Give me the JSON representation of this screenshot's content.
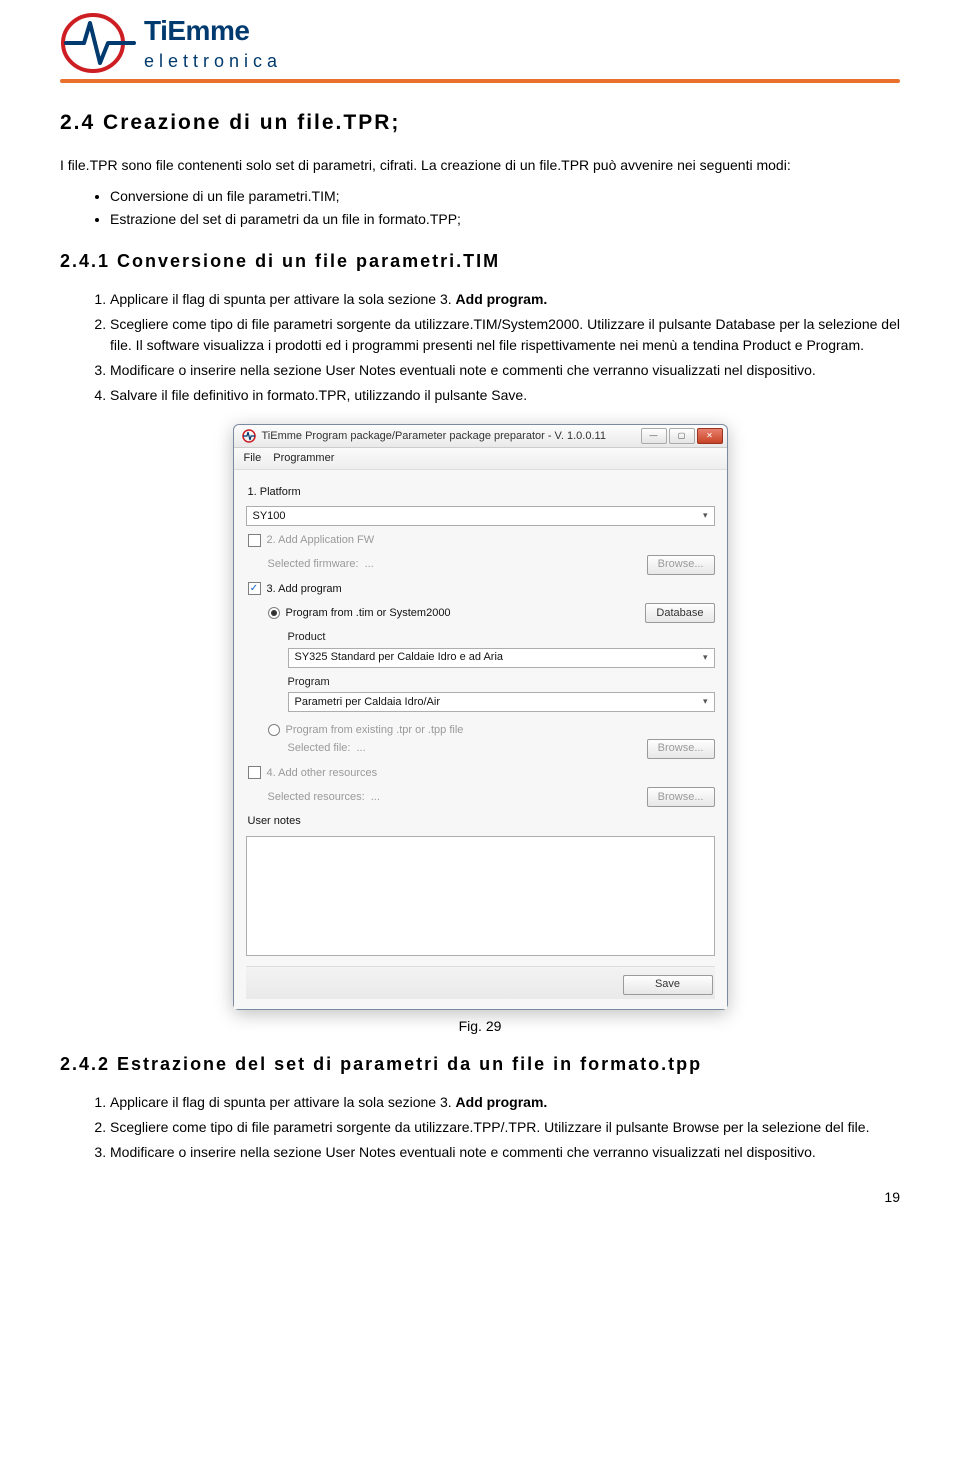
{
  "logo": {
    "brand_top": "TiEmme",
    "brand_bot": "elettronica"
  },
  "section24": {
    "title": "2.4   Creazione di un file.TPR;",
    "intro": "I file.TPR sono file contenenti solo set di parametri, cifrati. La creazione di un file.TPR può avvenire nei seguenti modi:",
    "bullets": [
      "Conversione di un file parametri.TIM;",
      "Estrazione del set di parametri da un file in formato.TPP;"
    ]
  },
  "section241": {
    "title": "2.4.1   Conversione di un file parametri.TIM",
    "steps": [
      "Applicare il flag di spunta per attivare la sola sezione 3. <b>Add program.</b>",
      "Scegliere come tipo di file parametri sorgente da utilizzare.TIM/System2000. Utilizzare il pulsante Database per la selezione del file. Il software visualizza i prodotti ed i programmi presenti nel file rispettivamente nei menù a tendina Product e Program.",
      "Modificare o inserire nella sezione User Notes eventuali note e commenti che verranno visualizzati nel dispositivo.",
      "Salvare il file definitivo in formato.TPR, utilizzando il pulsante Save."
    ]
  },
  "figure": {
    "caption": "Fig. 29"
  },
  "section242": {
    "title": "2.4.2   Estrazione del set di parametri da un file in formato.tpp",
    "steps": [
      "Applicare il flag di spunta per attivare la sola sezione 3. <b>Add program.</b>",
      "Scegliere come tipo di file parametri sorgente da utilizzare.TPP/.TPR. Utilizzare il pulsante Browse per la selezione del file.",
      "Modificare o inserire nella sezione User Notes eventuali note e commenti che verranno visualizzati nel dispositivo."
    ]
  },
  "screenshot": {
    "title": "TiEmme Program package/Parameter package preparator - V. 1.0.0.11",
    "menu": [
      "File",
      "Programmer"
    ],
    "s1": {
      "label": "1. Platform",
      "value": "SY100"
    },
    "s2": {
      "label": "2. Add Application FW",
      "sel_label": "Selected firmware:",
      "sel_value": "...",
      "browse": "Browse..."
    },
    "s3": {
      "label": "3. Add program",
      "radio1": "Program from .tim or System2000",
      "database_btn": "Database",
      "product_label": "Product",
      "product_value": "SY325 Standard per Caldaie Idro e ad Aria",
      "program_label": "Program",
      "program_value": "Parametri per Caldaia Idro/Air",
      "radio2": "Program from existing .tpr or .tpp file",
      "sel_file_label": "Selected file:",
      "sel_file_value": "...",
      "browse": "Browse..."
    },
    "s4": {
      "label": "4. Add other resources",
      "sel_label": "Selected resources:",
      "sel_value": "...",
      "browse": "Browse..."
    },
    "notes_label": "User notes",
    "save": "Save"
  },
  "page": "19"
}
